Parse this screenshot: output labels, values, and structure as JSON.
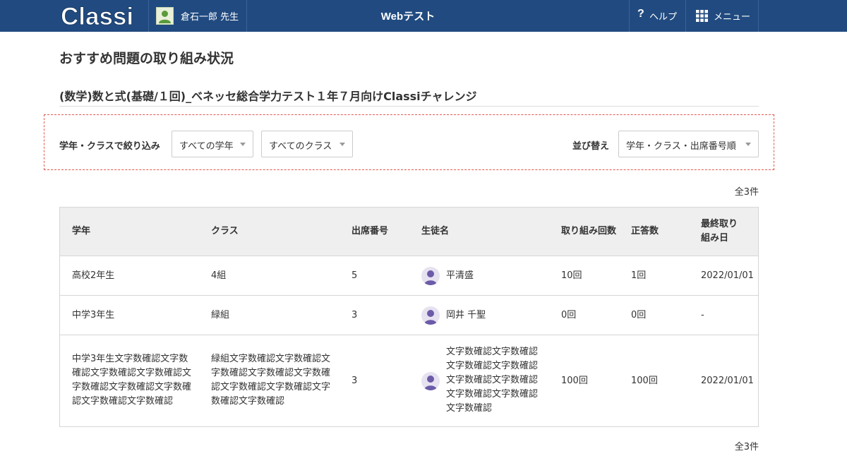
{
  "header": {
    "logo_text": "Classi",
    "user_name": "倉石一郎 先生",
    "app_title": "Webテスト",
    "help_label": "ヘルプ",
    "menu_label": "メニュー",
    "brand_color": "#214b80"
  },
  "page": {
    "title": "おすすめ問題の取り組み状況",
    "test_title": "(数学)数と式(基礎/１回)_ベネッセ総合学力テスト１年７月向けClassiチャレンジ"
  },
  "filter": {
    "label": "学年・クラスで絞り込み",
    "grade_select": "すべての学年",
    "class_select": "すべてのクラス",
    "sort_label": "並び替え",
    "sort_select": "学年・クラス・出席番号順"
  },
  "count_text": "全3件",
  "table": {
    "headers": {
      "grade": "学年",
      "class": "クラス",
      "number": "出席番号",
      "student": "生徒名",
      "attempts": "取り組み回数",
      "correct": "正答数",
      "last_date_1": "最終取り",
      "last_date_2": "組み日"
    },
    "rows": [
      {
        "grade": [
          "高校2年生"
        ],
        "class": [
          "4組"
        ],
        "number": "5",
        "student": [
          "平清盛"
        ],
        "attempts": "10回",
        "correct": "1回",
        "last_date": "2022/01/01"
      },
      {
        "grade": [
          "中学3年生"
        ],
        "class": [
          "緑組"
        ],
        "number": "3",
        "student": [
          "岡井 千聖"
        ],
        "attempts": "0回",
        "correct": "0回",
        "last_date": "-"
      },
      {
        "grade": [
          "中学3年生文字数確認文字数",
          "確認文字数確認文字数確認文",
          "字数確認文字数確認文字数確",
          "認文字数確認文字数確認"
        ],
        "class": [
          "緑組文字数確認文字数確認文",
          "字数確認文字数確認文字数確",
          "認文字数確認文字数確認文字",
          "数確認文字数確認"
        ],
        "number": "3",
        "student": [
          "文字数確認文字数確認",
          "文字数確認文字数確認",
          "文字数確認文字数確認",
          "文字数確認文字数確認",
          "文字数確認"
        ],
        "attempts": "100回",
        "correct": "100回",
        "last_date": "2022/01/01"
      }
    ]
  },
  "icons": {
    "help": "question-icon",
    "menu": "grid-icon",
    "user": "user-avatar-icon",
    "student": "student-avatar-icon",
    "caret": "caret-down-icon"
  }
}
